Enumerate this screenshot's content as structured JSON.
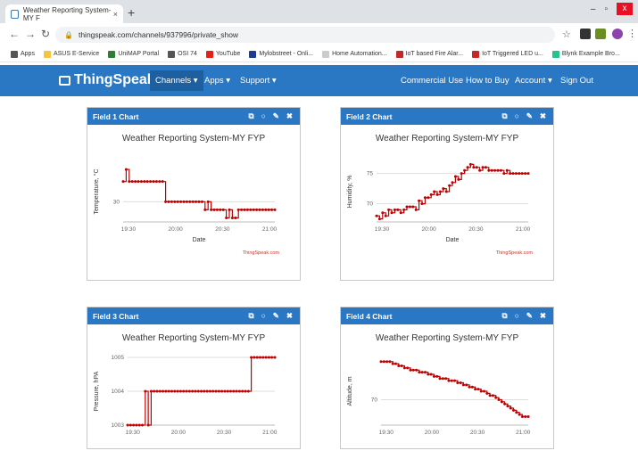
{
  "browser": {
    "tab_title": "Weather Reporting System-MY F",
    "tab_close": "×",
    "new_tab": "+",
    "url": "thingspeak.com/channels/937996/private_show",
    "window_controls": {
      "minimize": "–",
      "restore": "▫",
      "close": "x"
    }
  },
  "bookmarks": [
    {
      "label": "Apps",
      "icon": "apps-grid-icon",
      "color": "#555555"
    },
    {
      "label": "ASUS E-Service",
      "icon": "folder-icon",
      "color": "#f5c542"
    },
    {
      "label": "UniMAP Portal",
      "icon": "portal-icon",
      "color": "#2e7d32"
    },
    {
      "label": "OSI 74",
      "icon": "osi-icon",
      "color": "#555555"
    },
    {
      "label": "YouTube",
      "icon": "youtube-icon",
      "color": "#e62117"
    },
    {
      "label": "Mylobstreet - Onli...",
      "icon": "mylob-icon",
      "color": "#1d3c8f"
    },
    {
      "label": "Home Automation...",
      "icon": "home-icon",
      "color": "#cccccc"
    },
    {
      "label": "IoT based Fire Alar...",
      "icon": "iot-icon",
      "color": "#c62828"
    },
    {
      "label": "IoT Triggered LED u...",
      "icon": "iot-icon",
      "color": "#c62828"
    },
    {
      "label": "Blynk Example Bro...",
      "icon": "blynk-icon",
      "color": "#23c48e"
    }
  ],
  "navbar": {
    "brand": "ThingSpeak",
    "tm": "™",
    "channels": "Channels ▾",
    "apps": "Apps ▾",
    "support": "Support ▾",
    "commercial": "Commercial Use",
    "how_to_buy": "How to Buy",
    "account": "Account ▾",
    "sign_out": "Sign Out"
  },
  "panels": [
    {
      "header": "Field 1 Chart"
    },
    {
      "header": "Field 2 Chart"
    },
    {
      "header": "Field 3 Chart"
    },
    {
      "header": "Field 4 Chart"
    }
  ],
  "colors": {
    "brand": "#2a78c4",
    "series": "#c00000"
  },
  "chart_data": [
    {
      "type": "line",
      "title": "Weather Reporting System-MY FYP",
      "xlabel": "Date",
      "ylabel": "Temperature, °C",
      "credit": "ThingSpeak.com",
      "x_ticks": [
        "19:30",
        "20:00",
        "20:30",
        "21:00"
      ],
      "y_ticks": [
        {
          "label": "30",
          "value": 30
        }
      ],
      "xlim": [
        0,
        100
      ],
      "ylim": [
        29.5,
        31
      ],
      "x": [
        0,
        2,
        4,
        6,
        8,
        10,
        12,
        14,
        16,
        18,
        20,
        22,
        24,
        26,
        28,
        30,
        32,
        34,
        36,
        38,
        40,
        42,
        44,
        46,
        48,
        50,
        52,
        54,
        56,
        58,
        60,
        62,
        64,
        66,
        68,
        70,
        72,
        74,
        76,
        78,
        80,
        82,
        84,
        86,
        88,
        90,
        92,
        94,
        96,
        98,
        100
      ],
      "values": [
        30.5,
        30.8,
        30.5,
        30.5,
        30.5,
        30.5,
        30.5,
        30.5,
        30.5,
        30.5,
        30.5,
        30.5,
        30.5,
        30.5,
        30,
        30,
        30,
        30,
        30,
        30,
        30,
        30,
        30,
        30,
        30,
        30,
        30,
        29.8,
        30,
        29.8,
        29.8,
        29.8,
        29.8,
        29.8,
        29.6,
        29.8,
        29.6,
        29.6,
        29.8,
        29.8,
        29.8,
        29.8,
        29.8,
        29.8,
        29.8,
        29.8,
        29.8,
        29.8,
        29.8,
        29.8,
        29.8
      ]
    },
    {
      "type": "line",
      "title": "Weather Reporting System-MY FYP",
      "xlabel": "Date",
      "ylabel": "Humidity, %",
      "credit": "ThingSpeak.com",
      "x_ticks": [
        "19:30",
        "20:00",
        "20:30",
        "21:00"
      ],
      "y_ticks": [
        {
          "label": "75",
          "value": 75
        },
        {
          "label": "70",
          "value": 70
        }
      ],
      "xlim": [
        0,
        100
      ],
      "ylim": [
        67,
        77
      ],
      "x": [
        0,
        2,
        4,
        6,
        8,
        10,
        12,
        14,
        16,
        18,
        20,
        22,
        24,
        26,
        28,
        30,
        32,
        34,
        36,
        38,
        40,
        42,
        44,
        46,
        48,
        50,
        52,
        54,
        56,
        58,
        60,
        62,
        64,
        66,
        68,
        70,
        72,
        74,
        76,
        78,
        80,
        82,
        84,
        86,
        88,
        90,
        92,
        94,
        96,
        98,
        100
      ],
      "values": [
        68,
        67.5,
        68.5,
        68,
        69,
        68.5,
        69,
        69,
        68.5,
        69,
        69.5,
        69.5,
        69.5,
        69,
        70.5,
        70,
        71,
        71,
        71.5,
        72,
        71.5,
        72,
        72.5,
        72,
        73,
        73.5,
        74.5,
        74,
        75,
        75.5,
        76,
        76.5,
        76,
        76,
        75.5,
        76,
        76,
        75.5,
        75.5,
        75.5,
        75.5,
        75.5,
        75,
        75.5,
        75,
        75,
        75,
        75,
        75,
        75,
        75
      ]
    },
    {
      "type": "line",
      "title": "Weather Reporting System-MY FYP",
      "xlabel": "",
      "ylabel": "Pressure, hPA",
      "credit": "",
      "x_ticks": [
        "19:30",
        "20:00",
        "20:30",
        "21:00"
      ],
      "y_ticks": [
        {
          "label": "1005",
          "value": 1005
        },
        {
          "label": "1004",
          "value": 1004
        },
        {
          "label": "1003",
          "value": 1003
        }
      ],
      "xlim": [
        0,
        100
      ],
      "ylim": [
        1003,
        1005
      ],
      "x": [
        0,
        2,
        4,
        6,
        8,
        10,
        12,
        14,
        16,
        18,
        20,
        22,
        24,
        26,
        28,
        30,
        32,
        34,
        36,
        38,
        40,
        42,
        44,
        46,
        48,
        50,
        52,
        54,
        56,
        58,
        60,
        62,
        64,
        66,
        68,
        70,
        72,
        74,
        76,
        78,
        80,
        82,
        84,
        86,
        88,
        90,
        92,
        94,
        96,
        98,
        100
      ],
      "values": [
        1003,
        1003,
        1003,
        1003,
        1003,
        1003,
        1004,
        1003,
        1004,
        1004,
        1004,
        1004,
        1004,
        1004,
        1004,
        1004,
        1004,
        1004,
        1004,
        1004,
        1004,
        1004,
        1004,
        1004,
        1004,
        1004,
        1004,
        1004,
        1004,
        1004,
        1004,
        1004,
        1004,
        1004,
        1004,
        1004,
        1004,
        1004,
        1004,
        1004,
        1004,
        1004,
        1005,
        1005,
        1005,
        1005,
        1005,
        1005,
        1005,
        1005,
        1005
      ]
    },
    {
      "type": "line",
      "title": "Weather Reporting System-MY FYP",
      "xlabel": "",
      "ylabel": "Altitude, m",
      "credit": "",
      "x_ticks": [
        "19:30",
        "20:00",
        "20:30",
        "21:00"
      ],
      "y_ticks": [
        {
          "label": "70",
          "value": 70
        }
      ],
      "xlim": [
        0,
        100
      ],
      "ylim": [
        64,
        80
      ],
      "x": [
        0,
        2,
        4,
        6,
        8,
        10,
        12,
        14,
        16,
        18,
        20,
        22,
        24,
        26,
        28,
        30,
        32,
        34,
        36,
        38,
        40,
        42,
        44,
        46,
        48,
        50,
        52,
        54,
        56,
        58,
        60,
        62,
        64,
        66,
        68,
        70,
        72,
        74,
        76,
        78,
        80,
        82,
        84,
        86,
        88,
        90,
        92,
        94,
        96,
        98,
        100
      ],
      "values": [
        79,
        79,
        79,
        79,
        78.5,
        78.5,
        78,
        78,
        77.5,
        77.5,
        77,
        77,
        77,
        76.5,
        76.5,
        76.5,
        76,
        76,
        75.5,
        75.5,
        75,
        75,
        75,
        74.5,
        74.5,
        74.5,
        74,
        74,
        73.5,
        73.5,
        73,
        73,
        72.5,
        72.5,
        72,
        72,
        71.5,
        71,
        71,
        70.5,
        70,
        69.5,
        69,
        68.5,
        68,
        67.5,
        67,
        66.5,
        66,
        66,
        66
      ]
    }
  ]
}
